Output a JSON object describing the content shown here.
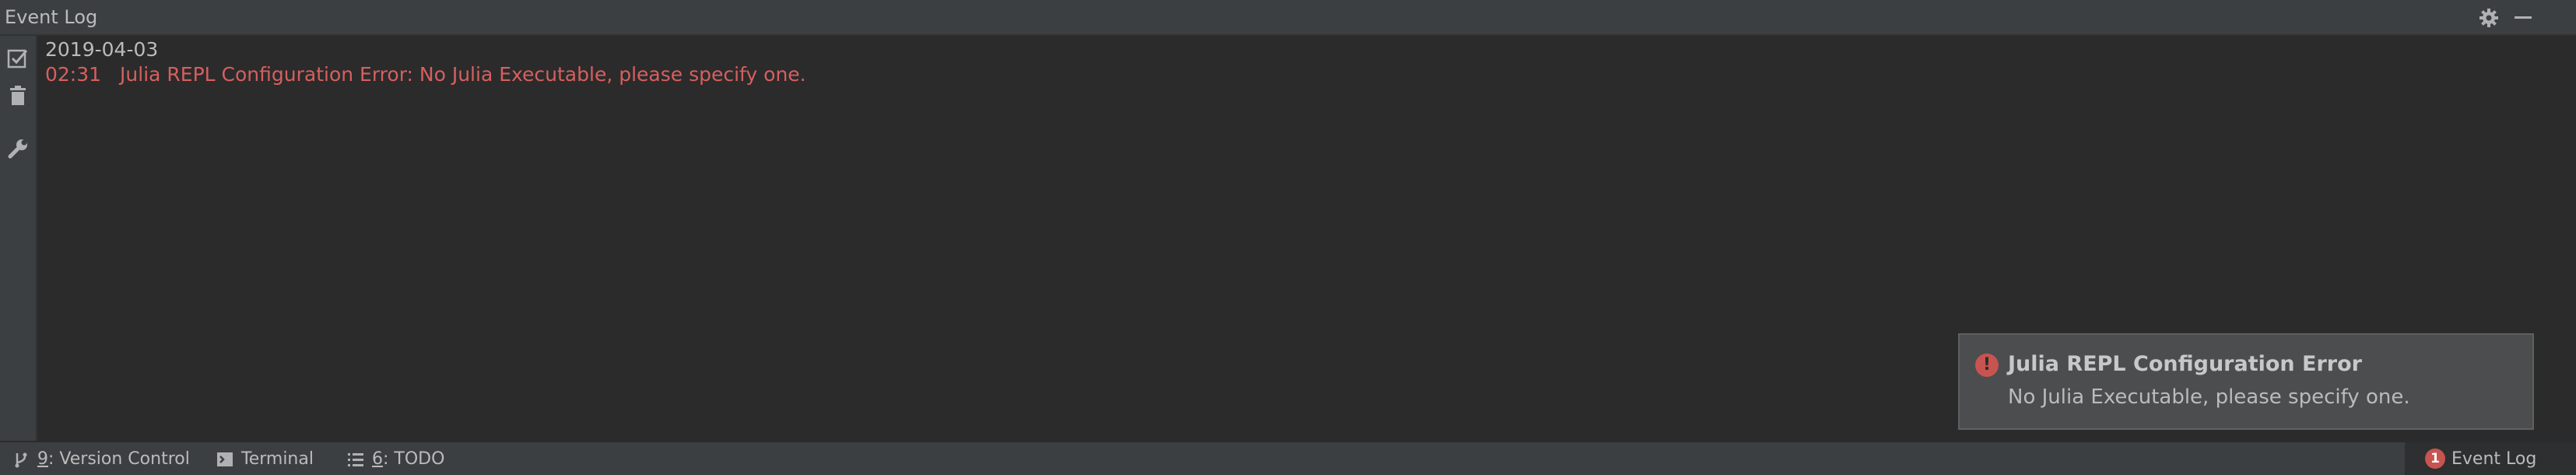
{
  "window": {
    "title": "Event Log"
  },
  "toolbar": {
    "icons": [
      "mark-read-icon",
      "trash-icon",
      "wrench-icon"
    ]
  },
  "log": {
    "date": "2019-04-03",
    "entries": [
      {
        "time": "02:31",
        "message": "Julia REPL Configuration Error: No Julia Executable, please specify one."
      }
    ]
  },
  "notification": {
    "title": "Julia REPL Configuration Error",
    "body": "No Julia Executable, please specify one.",
    "icon_glyph": "!"
  },
  "statusbar": {
    "version_control": {
      "mnemonic": "9",
      "label": ": Version Control"
    },
    "terminal": {
      "label": "Terminal"
    },
    "todo": {
      "mnemonic": "6",
      "label": ": TODO"
    },
    "event_log": {
      "badge": "1",
      "label": "Event Log"
    }
  },
  "colors": {
    "background": "#2b2b2b",
    "panel": "#3c3f41",
    "error_text": "#d75f5f",
    "error_icon": "#c75450",
    "text": "#bbbbbb"
  }
}
